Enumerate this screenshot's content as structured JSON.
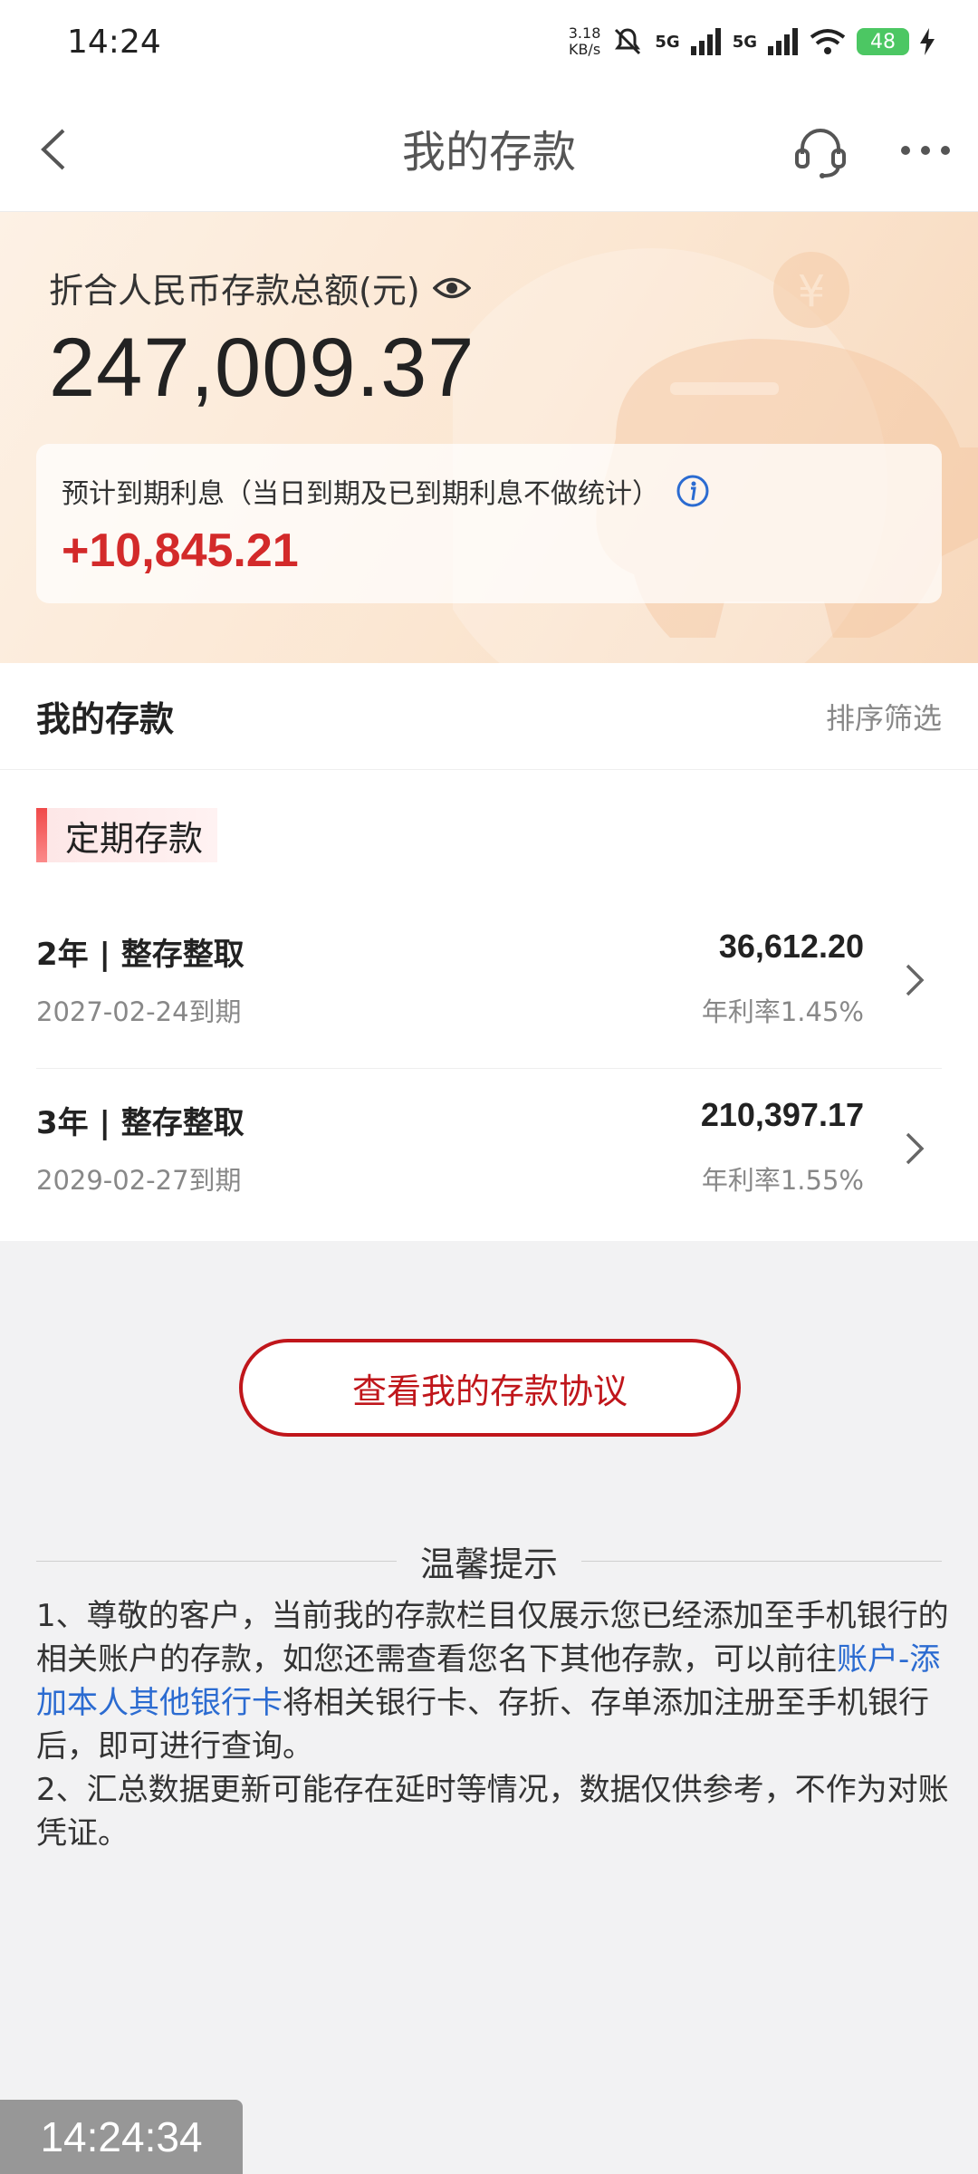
{
  "status_bar": {
    "time": "14:24",
    "net_speed_value": "3.18",
    "net_speed_unit": "KB/s",
    "signal1": "5G",
    "signal2": "5G",
    "battery": "48"
  },
  "nav": {
    "title": "我的存款"
  },
  "summary": {
    "total_label": "折合人民币存款总额(元)",
    "total_amount": "247,009.37",
    "interest_label": "预计到期利息（当日到期及已到期利息不做统计）",
    "interest_amount": "+10,845.21"
  },
  "deposits_section": {
    "title": "我的存款",
    "filter_label": "排序筛选",
    "category": "定期存款",
    "items": [
      {
        "name": "2年 | 整存整取",
        "maturity": "2027-02-24到期",
        "amount": "36,612.20",
        "rate": "年利率1.45%"
      },
      {
        "name": "3年 | 整存整取",
        "maturity": "2029-02-27到期",
        "amount": "210,397.17",
        "rate": "年利率1.55%"
      }
    ]
  },
  "agreement_button": "查看我的存款协议",
  "tips": {
    "title": "温馨提示",
    "p1_before": "1、尊敬的客户，当前我的存款栏目仅展示您已经添加至手机银行的相关账户的存款，如您还需查看您名下其他存款，可以前往",
    "p1_link": "账户-添加本人其他银行卡",
    "p1_after": "将相关银行卡、存折、存单添加注册至手机银行后，即可进行查询。",
    "p2": "2、汇总数据更新可能存在延时等情况，数据仅供参考，不作为对账凭证。"
  },
  "overlay_clock": "14:24:34",
  "colors": {
    "accent_red": "#c0161b",
    "interest_red": "#d32a2a",
    "link_blue": "#2b6bd1",
    "battery_green": "#4cc763"
  }
}
